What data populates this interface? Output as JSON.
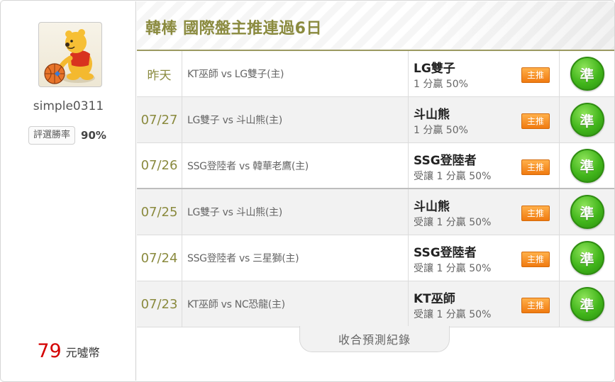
{
  "user": {
    "username": "simple0311",
    "winrate_label": "評選勝率",
    "winrate_value": "90%",
    "coins_value": "79",
    "coins_unit": "元噓幣"
  },
  "header": {
    "title": "韓棒 國際盤主推連過6日"
  },
  "rows": [
    {
      "date": "昨天",
      "match": "KT巫師 vs LG雙子(主)",
      "pick_team": "LG雙子",
      "pick_detail": "1 分贏 50%",
      "badge": "主推",
      "result": "準"
    },
    {
      "date": "07/27",
      "match": "LG雙子 vs 斗山熊(主)",
      "pick_team": "斗山熊",
      "pick_detail": "1 分贏 50%",
      "badge": "主推",
      "result": "準"
    },
    {
      "date": "07/26",
      "match": "SSG登陸者 vs 韓華老鷹(主)",
      "pick_team": "SSG登陸者",
      "pick_detail": "受讓 1 分贏 50%",
      "badge": "主推",
      "result": "準"
    },
    {
      "date": "07/25",
      "match": "LG雙子 vs 斗山熊(主)",
      "pick_team": "斗山熊",
      "pick_detail": "受讓 1 分贏 50%",
      "badge": "主推",
      "result": "準"
    },
    {
      "date": "07/24",
      "match": "SSG登陸者 vs 三星獅(主)",
      "pick_team": "SSG登陸者",
      "pick_detail": "受讓 1 分贏 50%",
      "badge": "主推",
      "result": "準"
    },
    {
      "date": "07/23",
      "match": "KT巫師 vs NC恐龍(主)",
      "pick_team": "KT巫師",
      "pick_detail": "受讓 1 分贏 50%",
      "badge": "主推",
      "result": "準"
    }
  ],
  "footer": {
    "collapse_label": "收合預測紀錄"
  },
  "colors": {
    "accent": "#8a8a3e",
    "badge": "#f07a10",
    "result": "#42b61b",
    "coins": "#d40000"
  },
  "icons": {
    "avatar": "cartoon-bear-with-basketball-avatar"
  }
}
